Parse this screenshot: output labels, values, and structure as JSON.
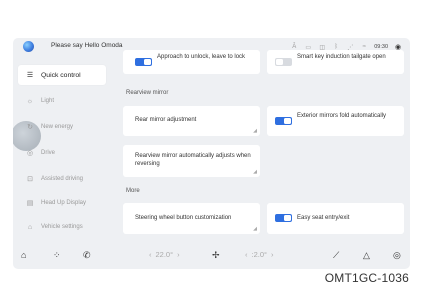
{
  "topbar": {
    "greeting": "Please say Hello Omoda",
    "icons": [
      "network-a-icon",
      "message-icon",
      "volume-icon",
      "bluetooth-icon",
      "signal-icon",
      "wifi-icon"
    ],
    "time": "09:30"
  },
  "sidebar": {
    "items": [
      {
        "label": "Quick control",
        "icon": "sliders-icon",
        "active": true
      },
      {
        "label": "Light",
        "icon": "sun-icon",
        "active": false
      },
      {
        "label": "New energy",
        "icon": "battery-icon",
        "active": false
      },
      {
        "label": "Drive",
        "icon": "steering-icon",
        "active": false
      },
      {
        "label": "Assisted driving",
        "icon": "car-icon",
        "active": false
      },
      {
        "label": "Head Up Display",
        "icon": "display-icon",
        "active": false
      },
      {
        "label": "Vehicle settings",
        "icon": "gear-icon",
        "active": false
      }
    ]
  },
  "content": {
    "card_approach": {
      "label": "Approach to unlock, leave to lock",
      "toggle": "on"
    },
    "card_smart_key": {
      "label": "Smart key induction tailgate open",
      "toggle": "off"
    },
    "section_rearview": "Rearview mirror",
    "card_rear_adjust": {
      "label": "Rear mirror adjustment"
    },
    "card_ext_fold": {
      "label": "Exterior mirrors fold automatically",
      "toggle": "on"
    },
    "card_reverse": {
      "label": "Rearview mirror automatically adjusts when reversing"
    },
    "section_more": "More",
    "card_steering": {
      "label": "Steering wheel button customization"
    },
    "card_easy_seat": {
      "label": "Easy seat entry/exit",
      "toggle": "on"
    }
  },
  "bottombar": {
    "left_temp": "22.0°",
    "right_temp": ":2.0°",
    "left_arrow": "‹",
    "right_arrow": "›"
  },
  "caption": "OMT1GC-1036",
  "colors": {
    "accent": "#2f6fe0",
    "screen_bg": "#eef0f3",
    "card_bg": "#ffffff"
  }
}
